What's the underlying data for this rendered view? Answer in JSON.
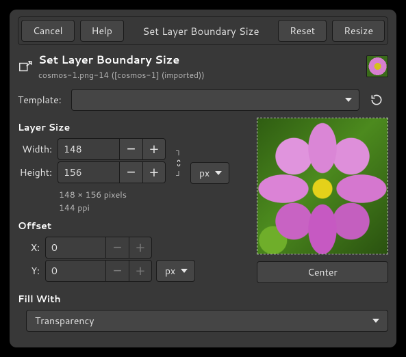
{
  "toolbar": {
    "cancel": "Cancel",
    "help": "Help",
    "window_title": "Set Layer Boundary Size",
    "reset": "Reset",
    "resize": "Resize"
  },
  "header": {
    "title": "Set Layer Boundary Size",
    "subtitle": "cosmos-1.png-14 ([cosmos-1] (imported))"
  },
  "template": {
    "label": "Template:",
    "value": ""
  },
  "layer_size": {
    "title": "Layer Size",
    "width_label": "Width:",
    "width_value": "148",
    "height_label": "Height:",
    "height_value": "156",
    "unit": "px",
    "hint_dims": "148 × 156 pixels",
    "hint_ppi": "144 ppi"
  },
  "offset": {
    "title": "Offset",
    "x_label": "X:",
    "x_value": "0",
    "y_label": "Y:",
    "y_value": "0",
    "unit": "px",
    "center": "Center"
  },
  "fill": {
    "title": "Fill With",
    "value": "Transparency"
  }
}
